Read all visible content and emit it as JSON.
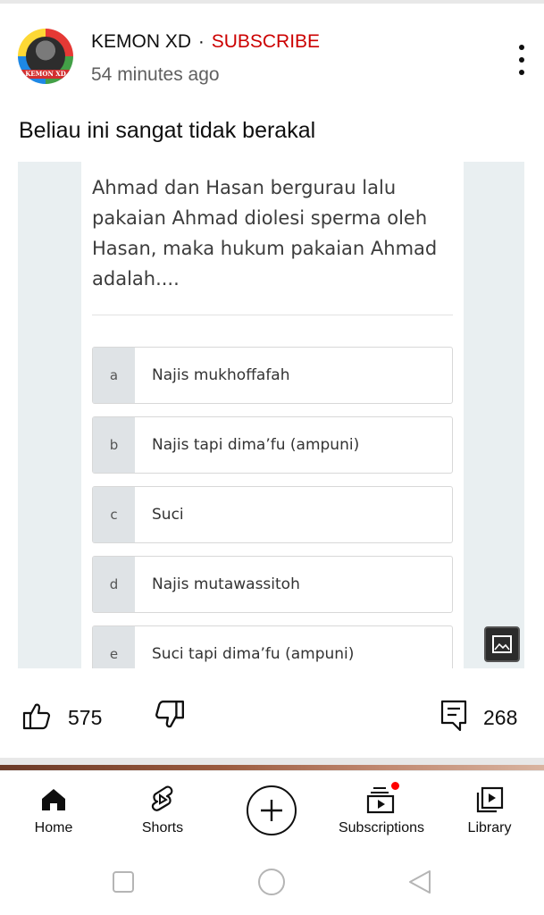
{
  "post": {
    "channel_name": "KEMON XD",
    "separator": "·",
    "subscribe_label": "SUBSCRIBE",
    "time_ago": "54 minutes ago",
    "avatar_text": "KEMON XD",
    "text": "Beliau ini sangat tidak berakal"
  },
  "quiz": {
    "question": "Ahmad dan Hasan bergurau lalu pakaian Ahmad diolesi sperma oleh Hasan, maka hukum pakaian Ahmad adalah....",
    "options": [
      {
        "letter": "a",
        "text": "Najis mukhoffafah"
      },
      {
        "letter": "b",
        "text": "Najis tapi dima’fu (ampuni)"
      },
      {
        "letter": "c",
        "text": "Suci"
      },
      {
        "letter": "d",
        "text": "Najis mutawassitoh"
      },
      {
        "letter": "e",
        "text": "Suci tapi dima’fu (ampuni)"
      }
    ]
  },
  "actions": {
    "likes": "575",
    "comments": "268"
  },
  "bottom_nav": {
    "items": [
      {
        "label": "Home",
        "icon": "home-icon"
      },
      {
        "label": "Shorts",
        "icon": "shorts-icon"
      },
      {
        "label": "",
        "icon": "create-plus-icon"
      },
      {
        "label": "Subscriptions",
        "icon": "subscriptions-icon"
      },
      {
        "label": "Library",
        "icon": "library-icon"
      }
    ]
  },
  "system_nav": [
    "recent-apps-icon",
    "home-circle-icon",
    "back-triangle-icon"
  ],
  "colors": {
    "subscribe_red": "#cc0000",
    "text_primary": "#0f0f0f",
    "text_secondary": "#606060",
    "notification_dot": "#ff0000"
  }
}
